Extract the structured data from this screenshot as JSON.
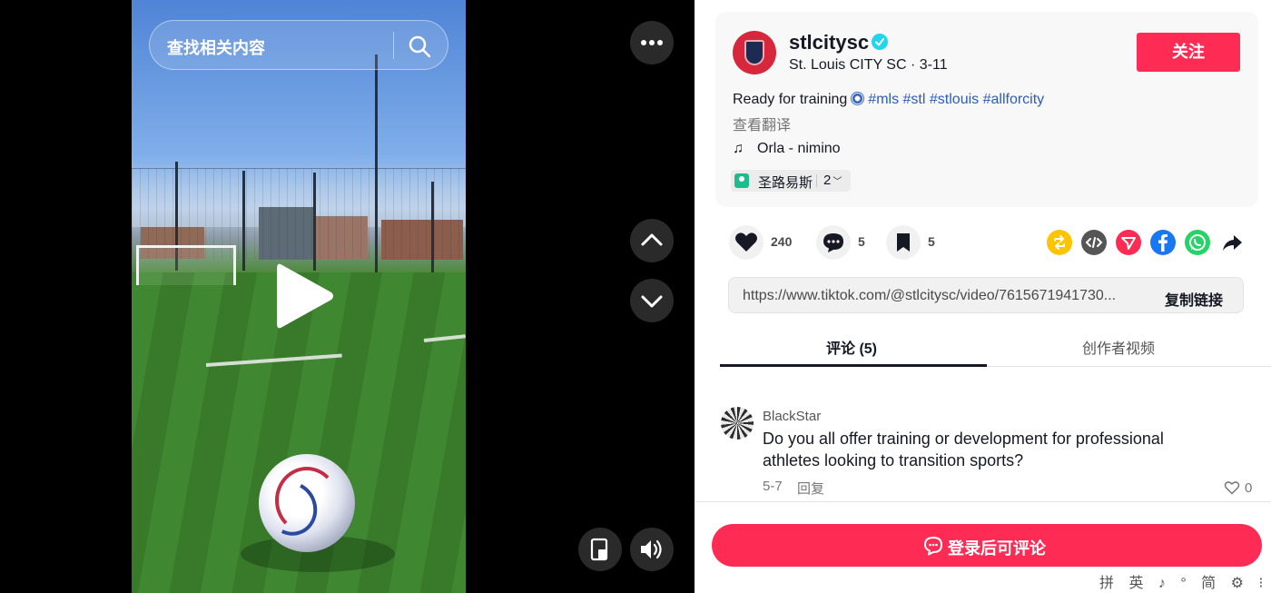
{
  "video": {
    "search_placeholder": "查找相关内容",
    "icons": [
      "search-icon",
      "play-icon",
      "more-icon",
      "chevron-up-icon",
      "chevron-down-icon",
      "floating-player-icon",
      "volume-icon"
    ]
  },
  "author": {
    "username": "stlcitysc",
    "nickname_line": "St. Louis CITY SC · 3-11",
    "follow_label": "关注",
    "verified": true
  },
  "description": {
    "text": "Ready for training",
    "hashtags": [
      "#mls",
      "#stl",
      "#stlouis",
      "#allforcity"
    ],
    "translate_label": "查看翻译"
  },
  "music": {
    "title": "Orla - nimino"
  },
  "location": {
    "name": "圣路易斯",
    "count": "2"
  },
  "actions": {
    "likes": "240",
    "comments": "5",
    "favorites": "5"
  },
  "share": {
    "icons": [
      "repost-icon",
      "embed-icon",
      "send-icon",
      "facebook-icon",
      "whatsapp-icon",
      "share-arrow-icon"
    ],
    "colors": {
      "repost": "#ffc300",
      "embed": "#555555",
      "send": "#fe2c55",
      "facebook": "#1877f2",
      "whatsapp": "#25d366"
    }
  },
  "link": {
    "url": "https://www.tiktok.com/@stlcitysc/video/7615671941730...",
    "copy_label": "复制链接"
  },
  "tabs": [
    {
      "label": "评论 (5)",
      "active": true
    },
    {
      "label": "创作者视频",
      "active": false
    }
  ],
  "comments": [
    {
      "user": "BlackStar",
      "text": "Do you all offer training or development for professional athletes looking to transition sports?",
      "date": "5-7",
      "reply_label": "回复",
      "likes": "0"
    }
  ],
  "login": {
    "label": "登录后可评论"
  },
  "ime": {
    "text": "拼 英 ♪ ° 简 ⚙ ⁝"
  },
  "colors": {
    "accent": "#fe2c55",
    "hashtag": "#2b5db9",
    "verified": "#20d5ec"
  }
}
